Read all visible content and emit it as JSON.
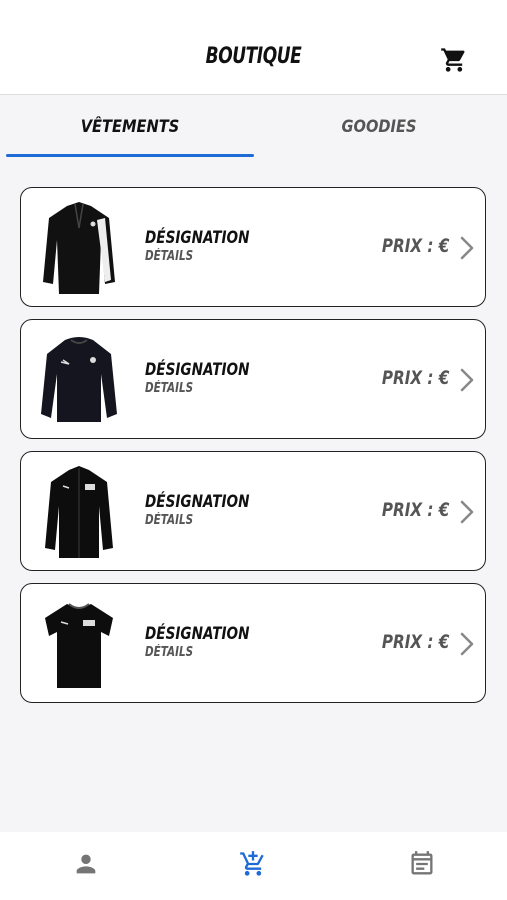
{
  "header": {
    "title": "BOUTIQUE",
    "cart_icon": "cart-icon"
  },
  "tabs": [
    {
      "label": "VÊTEMENTS",
      "active": true
    },
    {
      "label": "GOODIES",
      "active": false
    }
  ],
  "products": [
    {
      "designation": "DÉSIGNATION",
      "details": "DÉTAILS",
      "price": "PRIX : €",
      "image": "quarter-zip-training-top"
    },
    {
      "designation": "DÉSIGNATION",
      "details": "DÉTAILS",
      "price": "PRIX : €",
      "image": "crew-sweatshirt"
    },
    {
      "designation": "DÉSIGNATION",
      "details": "DÉTAILS",
      "price": "PRIX : €",
      "image": "track-jacket"
    },
    {
      "designation": "DÉSIGNATION",
      "details": "DÉTAILS",
      "price": "PRIX : €",
      "image": "t-shirt"
    }
  ],
  "bottom_nav": [
    {
      "icon": "person-icon",
      "active": false
    },
    {
      "icon": "add-shopping-cart-icon",
      "active": true
    },
    {
      "icon": "calendar-icon",
      "active": false
    }
  ],
  "colors": {
    "accent": "#1e6bd6",
    "text_dark": "#111111",
    "text_muted": "#555555",
    "icon_grey": "#757575"
  }
}
